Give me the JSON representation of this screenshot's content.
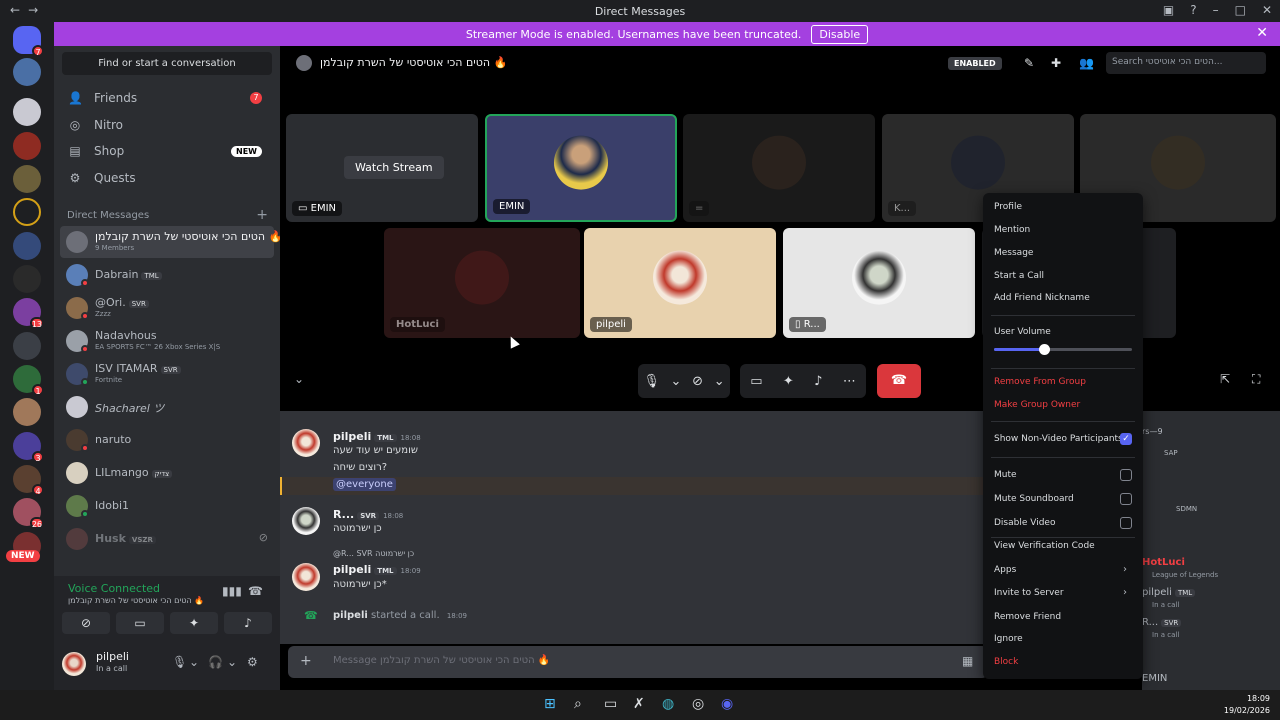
{
  "window": {
    "title": "Direct Messages",
    "nav_back": "←",
    "nav_forward": "→"
  },
  "banner": {
    "text": "Streamer Mode is enabled. Usernames have been truncated.",
    "disable_label": "Disable",
    "close": "✕"
  },
  "servers": {
    "badges": [
      "7",
      "13",
      "1",
      "3",
      "4",
      "26"
    ],
    "new_label": "NEW"
  },
  "sidebar": {
    "find": "Find or start a conversation",
    "nav": [
      {
        "label": "Friends",
        "badge": "7"
      },
      {
        "label": "Nitro"
      },
      {
        "label": "Shop",
        "badge": "NEW"
      },
      {
        "label": "Quests"
      }
    ],
    "dm_header": "Direct Messages",
    "dms": [
      {
        "name": "הטים הכי אוטיסטי של השרת קובלמן 🔥",
        "sub": "9 Members"
      },
      {
        "name": "Dabrain",
        "tag": "TML"
      },
      {
        "name": "@Ori.",
        "tag": "SVR",
        "sub": "Zzzz"
      },
      {
        "name": "Nadavhous",
        "sub": "EA SPORTS FC™ 26 Xbox Series X|S"
      },
      {
        "name": "ISV ITAMAR",
        "tag": "SVR",
        "sub": "Fortnite"
      },
      {
        "name": "Shacharel ツ"
      },
      {
        "name": "naruto"
      },
      {
        "name": "LILmango",
        "tag": "צדיק"
      },
      {
        "name": "Idobi1"
      },
      {
        "name": "Husk",
        "tag": "VSZR"
      }
    ]
  },
  "voice": {
    "status": "Voice Connected",
    "channel": "הטים הכי אוטיסטי של השרת קובלמן 🔥"
  },
  "user": {
    "name": "pilpeli",
    "status": "In a call"
  },
  "channel": {
    "title": "הטים הכי אוטיסטי של השרת קובלמן 🔥",
    "enabled_badge": "ENABLED",
    "search_placeholder": "Search הטים הכי אוטיסטי..."
  },
  "call": {
    "watch_stream": "Watch Stream",
    "tiles": [
      "EMIN",
      "EMIN",
      "=",
      "K...",
      "HotLuci",
      "pilpeli",
      "R..."
    ]
  },
  "messages": [
    {
      "author": "pilpeli",
      "tag": "TML",
      "time": "18:08",
      "lines": [
        "שומעים יש עוד שעה",
        "רוצים שיחה?"
      ],
      "mention": "@everyone"
    },
    {
      "author": "R...",
      "tag": "SVR",
      "time": "18:08",
      "lines": [
        "כן ישרמוטה"
      ]
    },
    {
      "reply_to": "@R... SVR כן ישרמוטה",
      "author": "pilpeli",
      "tag": "TML",
      "time": "18:09",
      "lines": [
        "כן ישרמוטה*"
      ]
    }
  ],
  "call_log": {
    "author": "pilpeli",
    "text": "started a call.",
    "time": "18:09"
  },
  "composer": {
    "placeholder": "Message הטים הכי אוטיסטי של השרת קובלמן 🔥"
  },
  "members": {
    "header": "rs—9",
    "items": [
      {
        "name": "SAP"
      },
      {
        "name": "SDMN"
      },
      {
        "name": "HotLuci",
        "sub": "League of Legends"
      },
      {
        "name": "pilpeli",
        "tag": "TML",
        "sub": "In a call"
      },
      {
        "name": "R...",
        "tag": "SVR",
        "sub": "In a call"
      },
      {
        "name": "EMIN"
      }
    ]
  },
  "context_menu": {
    "items": [
      "Profile",
      "Mention",
      "Message",
      "Start a Call",
      "Add Friend Nickname"
    ],
    "volume_label": "User Volume",
    "volume": 0.36,
    "danger": [
      "Remove From Group",
      "Make Group Owner"
    ],
    "toggle": {
      "label": "Show Non-Video Participants",
      "checked": true
    },
    "checks": [
      "Mute",
      "Mute Soundboard",
      "Disable Video"
    ],
    "more": [
      "View Verification Code",
      "Apps",
      "Invite to Server",
      "Remove Friend",
      "Ignore"
    ],
    "block": "Block"
  },
  "clock": {
    "time": "18:09",
    "date": "19/02/2026"
  },
  "colors": {
    "accent": "#5865f2",
    "banner": "#a440e0",
    "danger": "#f23f43",
    "online": "#23a55a"
  }
}
